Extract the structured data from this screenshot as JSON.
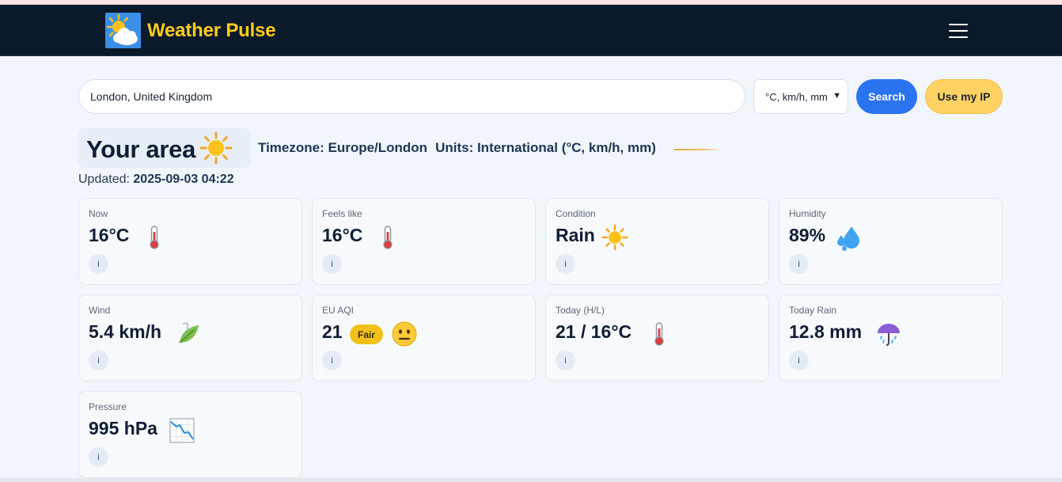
{
  "header": {
    "brand_name": "Weather Pulse",
    "logo_icon": "sun-cloud-icon",
    "menu_icon": "hamburger-menu-icon",
    "brand_color": "#ffcc1a",
    "nav_bg": "#0b1a2b"
  },
  "search": {
    "value": "London, United Kingdom",
    "units_selected": "°C, km/h, mm",
    "search_label": "Search",
    "ip_label": "Use my IP"
  },
  "location": {
    "title": "Your area",
    "title_icon": "sun-icon",
    "timezone": "Timezone: Europe/London",
    "units": "Units: International (°C, km/h, mm)",
    "updated_label": "Updated:",
    "updated_value": "2025-09-03 04:22"
  },
  "cards": [
    {
      "label": "Now",
      "value": "16°C",
      "icon": "thermometer-icon"
    },
    {
      "label": "Feels like",
      "value": "16°C",
      "icon": "thermometer-icon"
    },
    {
      "label": "Condition",
      "value": "Rain",
      "icon": "sun-icon"
    },
    {
      "label": "Humidity",
      "value": "89%",
      "icon": "water-drops-icon"
    },
    {
      "label": "Wind",
      "value": "5.4 km/h",
      "icon": "leaf-wind-icon"
    },
    {
      "label": "EU AQI",
      "value": "21",
      "badge": "Fair",
      "icon": "neutral-face-icon"
    },
    {
      "label": "Today (H/L)",
      "value": "21 / 16°C",
      "icon": "thermometer-icon"
    },
    {
      "label": "Today Rain",
      "value": "12.8 mm",
      "icon": "umbrella-rain-icon"
    },
    {
      "label": "Pressure",
      "value": "995 hPa",
      "icon": "chart-decreasing-icon"
    }
  ],
  "info_label": "i",
  "colors": {
    "accent_blue": "#2b74f0",
    "accent_yellow": "#ffd263",
    "badge_fair": "#f1c01a",
    "page_bg": "#f1f6fc"
  }
}
